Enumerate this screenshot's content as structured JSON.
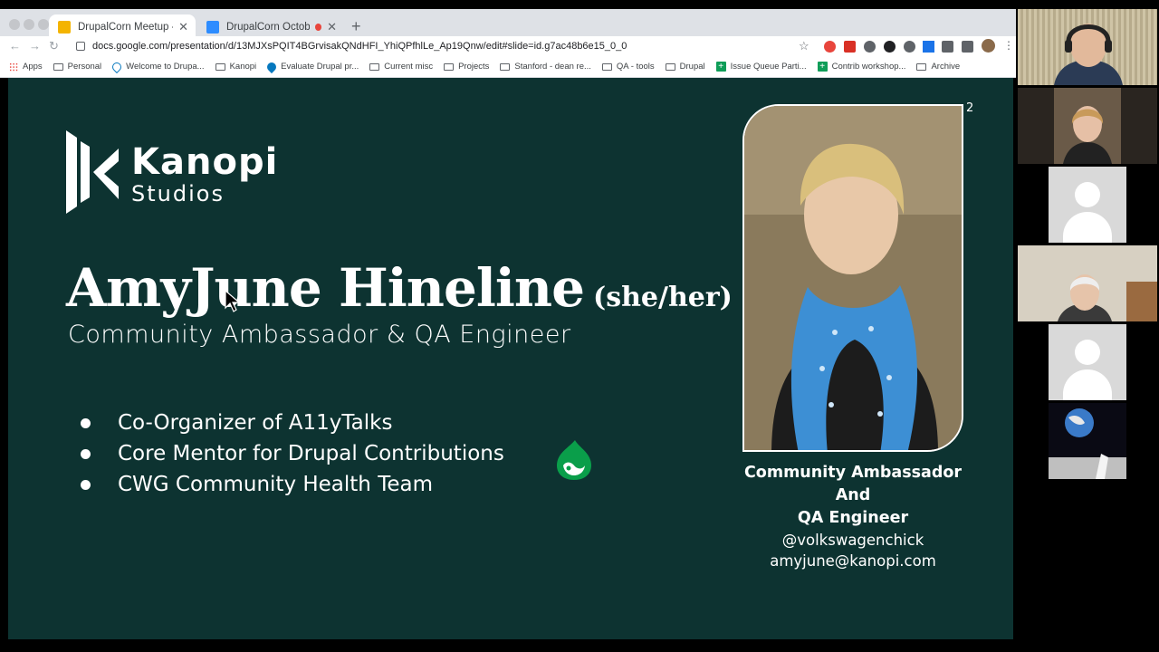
{
  "browser": {
    "tabs": [
      {
        "title": "DrupalCorn Meetup - Accessib",
        "active": true,
        "favicon_color": "#f4b400"
      },
      {
        "title": "DrupalCorn October Meeting",
        "active": false,
        "favicon_color": "#2d8cff"
      }
    ],
    "url": "docs.google.com/presentation/d/13MJXsPQIT4BGrvisakQNdHFI_YhiQPfhlLe_Ap19Qnw/edit#slide=id.g7ac48b6e15_0_0",
    "bookmarks": [
      {
        "label": "Apps",
        "icon": "apps-grid-icon"
      },
      {
        "label": "Personal",
        "icon": "folder-icon"
      },
      {
        "label": "Welcome to Drupa...",
        "icon": "drupal-icon"
      },
      {
        "label": "Kanopi",
        "icon": "folder-icon"
      },
      {
        "label": "Evaluate Drupal pr...",
        "icon": "drupal-icon"
      },
      {
        "label": "Current misc",
        "icon": "folder-icon"
      },
      {
        "label": "Projects",
        "icon": "folder-icon"
      },
      {
        "label": "Stanford - dean re...",
        "icon": "folder-icon"
      },
      {
        "label": "QA - tools",
        "icon": "folder-icon"
      },
      {
        "label": "Drupal",
        "icon": "folder-icon"
      },
      {
        "label": "Issue Queue Parti...",
        "icon": "sheets-icon"
      },
      {
        "label": "Contrib workshop...",
        "icon": "sheets-icon"
      },
      {
        "label": "Archive",
        "icon": "folder-icon"
      }
    ]
  },
  "slide": {
    "logo_line1": "Kanopi",
    "logo_line2": "Studios",
    "name": "AmyJune Hineline",
    "pronouns": "(she/her)",
    "role": "Community Ambassador & QA Engineer",
    "bullets": [
      "Co-Organizer of A11yTalks",
      "Core Mentor for Drupal Contributions",
      "CWG Community Health Team"
    ],
    "slide_number": "2",
    "caption": {
      "line1": "Community Ambassador",
      "line2": "And",
      "line3": "QA Engineer",
      "handle": "@volkswagenchick",
      "email": "amyjune@kanopi.com"
    },
    "background_color": "#0d3331",
    "accent_color": "#0a9e4a"
  }
}
